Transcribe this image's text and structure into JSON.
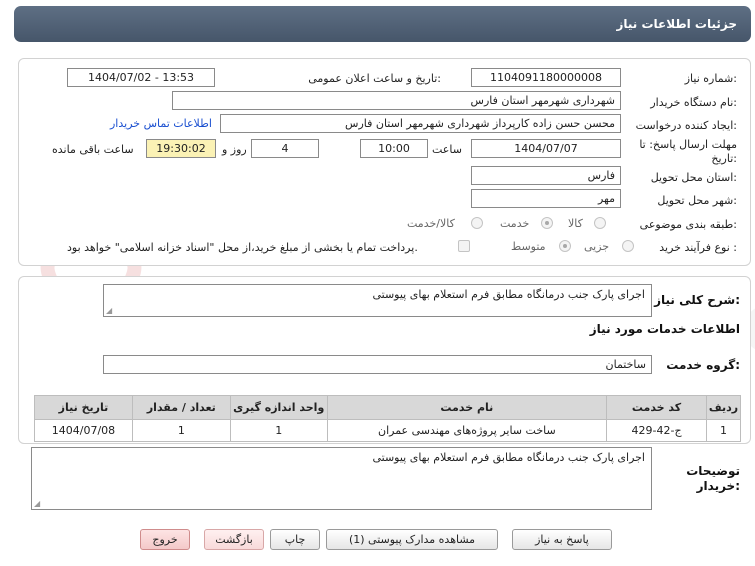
{
  "header": {
    "title": "جزئیات اطلاعات نیاز"
  },
  "details": {
    "need_number_label": "شماره نیاز:",
    "need_number": "1104091180000008",
    "announce_label": "تاریخ و ساعت اعلان عمومی:",
    "announce_value": "1404/07/02 - 13:53",
    "buyer_org_label": "نام دستگاه خریدار:",
    "buyer_org": "شهرداری شهرمهر استان فارس",
    "creator_label": "ایجاد کننده درخواست:",
    "creator": "محسن حسن زاده کارپرداز شهرداری شهرمهر استان فارس",
    "contact_link": "اطلاعات تماس خریدار",
    "deadline_label": "مهلت ارسال پاسخ: تا تاریخ:",
    "deadline_date": "1404/07/07",
    "time_label": "ساعت",
    "deadline_time": "10:00",
    "days_value": "4",
    "days_label": "روز و",
    "remaining_time": "19:30:02",
    "remaining_label": "ساعت باقی مانده",
    "province_label": "استان محل تحویل:",
    "province": "فارس",
    "city_label": "شهر محل تحویل:",
    "city": "مهر",
    "category_label": "طبقه بندی موضوعی:",
    "category_options": [
      "کالا",
      "خدمت",
      "کالا/خدمت"
    ],
    "process_label": "نوع فرآیند خرید :",
    "process_options": [
      "جزیی",
      "متوسط"
    ],
    "payment_note": "پرداخت تمام یا بخشی از مبلغ خرید،از محل \"اسناد خزانه اسلامی\" خواهد بود."
  },
  "summary": {
    "label": "شرح کلی نیاز:",
    "text": "اجرای پارک جنب درمانگاه مطابق فرم استعلام بهای پیوستی"
  },
  "services": {
    "heading": "اطلاعات خدمات مورد نیاز",
    "group_label": "گروه خدمت:",
    "group_value": "ساختمان",
    "columns": [
      "ردیف",
      "کد خدمت",
      "نام خدمت",
      "واحد اندازه گیری",
      "تعداد / مقدار",
      "تاریخ نیاز"
    ],
    "rows": [
      [
        "1",
        "ج-42-429",
        "ساخت سایر پروژه‌های مهندسی عمران",
        "1",
        "1",
        "1404/07/08"
      ]
    ]
  },
  "buyer_notes": {
    "label": "توضیحات خریدار:",
    "text": "اجرای پارک جنب درمانگاه مطابق فرم استعلام بهای پیوستی"
  },
  "buttons": {
    "reply": "پاسخ به نیاز",
    "attachments": "مشاهده مدارک پیوستی (1)",
    "print": "چاپ",
    "back": "بازگشت",
    "exit": "خروج"
  },
  "watermark": {
    "text": "AriaTender.net"
  },
  "colors": {
    "header": "#4f6075",
    "link": "#1a4fd0",
    "time_highlight": "#fbf2b5",
    "watermark": "#f1d2d2"
  }
}
